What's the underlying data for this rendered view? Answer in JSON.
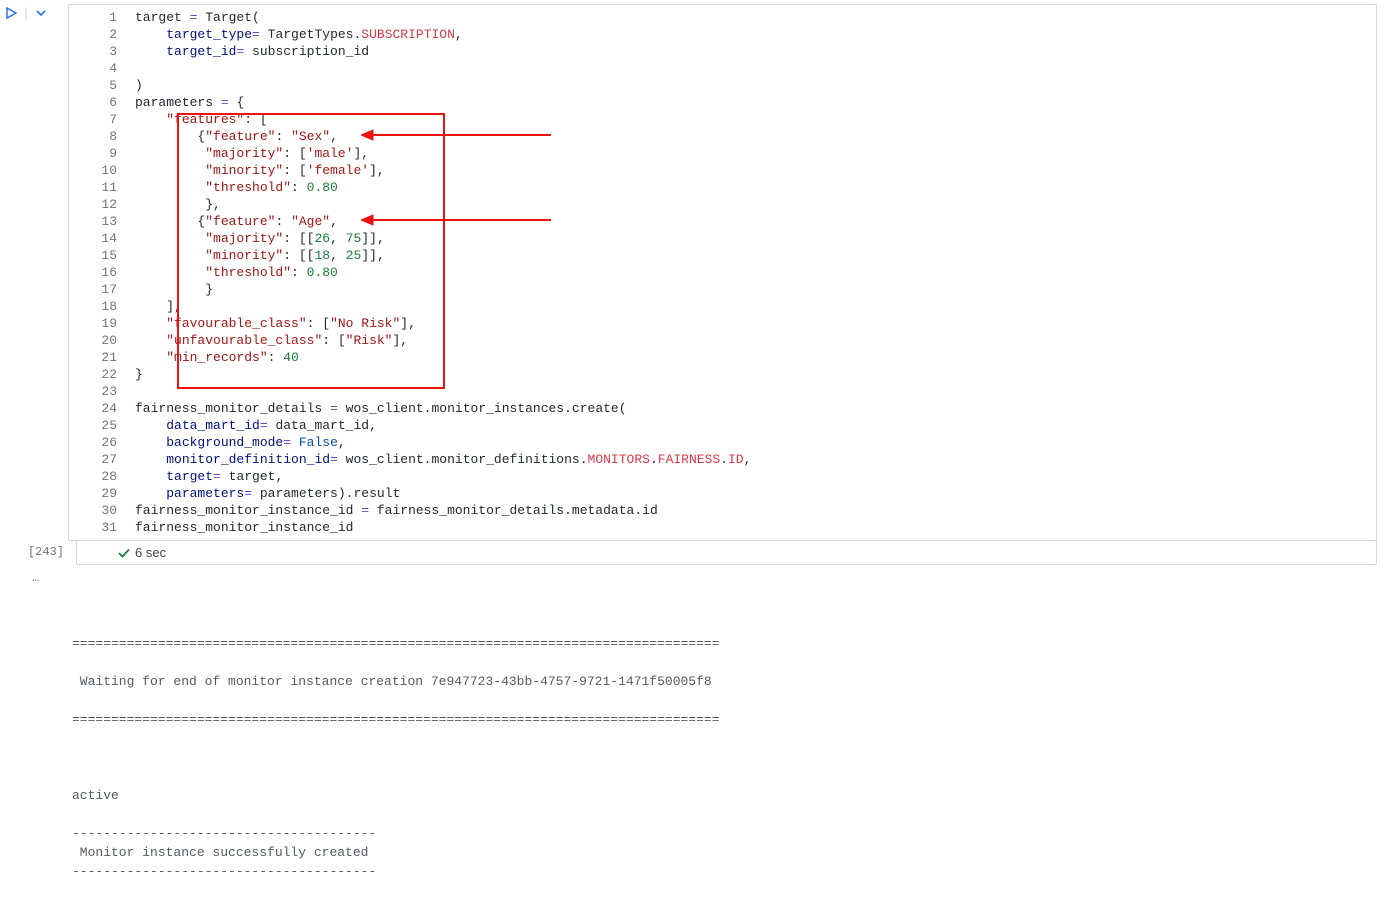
{
  "toolbar": {
    "run_label": "Run",
    "chev_label": "More"
  },
  "cell": {
    "exec_count": "[243]",
    "exec_time": "6 sec",
    "lines": {
      "l1": {
        "n": "1"
      },
      "l2": {
        "n": "2"
      },
      "l3": {
        "n": "3"
      },
      "l4": {
        "n": "4"
      },
      "l5": {
        "n": "5"
      },
      "l6": {
        "n": "6"
      },
      "l7": {
        "n": "7"
      },
      "l8": {
        "n": "8"
      },
      "l9": {
        "n": "9"
      },
      "l10": {
        "n": "10"
      },
      "l11": {
        "n": "11"
      },
      "l12": {
        "n": "12"
      },
      "l13": {
        "n": "13"
      },
      "l14": {
        "n": "14"
      },
      "l15": {
        "n": "15"
      },
      "l16": {
        "n": "16"
      },
      "l17": {
        "n": "17"
      },
      "l18": {
        "n": "18"
      },
      "l19": {
        "n": "19"
      },
      "l20": {
        "n": "20"
      },
      "l21": {
        "n": "21"
      },
      "l22": {
        "n": "22"
      },
      "l23": {
        "n": "23"
      },
      "l24": {
        "n": "24"
      },
      "l25": {
        "n": "25"
      },
      "l26": {
        "n": "26"
      },
      "l27": {
        "n": "27"
      },
      "l28": {
        "n": "28"
      },
      "l29": {
        "n": "29"
      },
      "l30": {
        "n": "30"
      },
      "l31": {
        "n": "31"
      }
    },
    "code": {
      "t_target": "target ",
      "t_eq": "= ",
      "t_Target": "Target",
      "t_op_paren": "(",
      "t_cl_paren": ")",
      "t_tt": "target_type",
      "t_TT": "TargetTypes",
      "t_dot": ".",
      "t_SUB": "SUBSCRIPTION",
      "t_comma": ",",
      "t_ti": "target_id",
      "t_sid": "subscription_id",
      "t_blank": "",
      "t_params": "parameters ",
      "t_ob": "{",
      "t_cb": "}",
      "t_features": "\"features\"",
      "t_colon": ": ",
      "t_osb": "[",
      "t_csb": "]",
      "t_feature": "\"feature\"",
      "t_Sex": "\"Sex\"",
      "t_Age": "\"Age\"",
      "t_majority": "\"majority\"",
      "t_minority": "\"minority\"",
      "t_threshold": "\"threshold\"",
      "t_male": "'male'",
      "t_female": "'female'",
      "t_080": "0.80",
      "t_26": "26",
      "t_75": "75",
      "t_18": "18",
      "t_25": "25",
      "t_fav": "\"favourable_class\"",
      "t_unfav": "\"unfavourable_class\"",
      "t_NoRisk": "\"No Risk\"",
      "t_Risk": "\"Risk\"",
      "t_minrec": "\"min_records\"",
      "t_40": "40",
      "t_fmd": "fairness_monitor_details ",
      "t_wos": "wos_client",
      "t_mi": "monitor_instances",
      "t_create": "create",
      "t_dmi": "data_mart_id",
      "t_bgm": "background_mode",
      "t_False": "False",
      "t_mdi": "monitor_definition_id",
      "t_md": "monitor_definitions",
      "t_MON": "MONITORS",
      "t_FAIR": "FAIRNESS",
      "t_ID": "ID",
      "t_tgt": "target",
      "t_prm": "parameters",
      "t_res": "result",
      "t_fmii": "fairness_monitor_instance_id ",
      "t_meta": "metadata",
      "t_id": "id"
    }
  },
  "ellipsis": "…",
  "output": {
    "bar1": "===================================================================================",
    "wait": " Waiting for end of monitor instance creation 7e947723-43bb-4757-9721-1471f50005f8",
    "bar2": "===================================================================================",
    "active": "active",
    "dash1": "---------------------------------------",
    "success": " Monitor instance successfully created ",
    "dash2": "---------------------------------------"
  }
}
